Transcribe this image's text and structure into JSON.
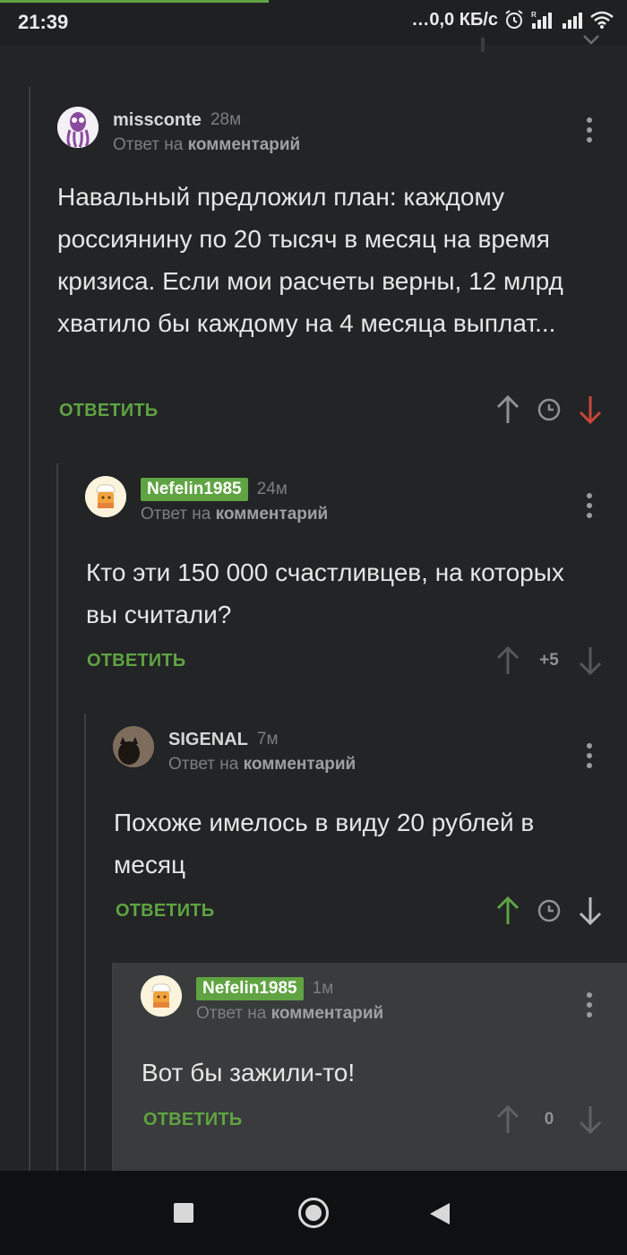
{
  "status_bar": {
    "time": "21:39",
    "network_speed": "…0,0 КБ/с",
    "icons": [
      "alarm-icon",
      "signal-icon",
      "signal-icon",
      "wifi-icon"
    ]
  },
  "comments": [
    {
      "author": "missconte",
      "author_badge": false,
      "ago": "28м",
      "reply_prefix": "Ответ на",
      "reply_target": "комментарий",
      "text": "Навальный предложил план: каждому россиянину по 20 тысяч в месяц на время кризиса. Если мои расчеты верны, 12 млрд хватило бы каждому на 4 месяца выплат...",
      "reply_label": "ОТВЕТИТЬ",
      "score": "",
      "vote": "down"
    },
    {
      "author": "Nefelin1985",
      "author_badge": true,
      "ago": "24м",
      "reply_prefix": "Ответ на",
      "reply_target": "комментарий",
      "text": "Кто эти 150 000 счастливцев, на которых вы считали?",
      "reply_label": "ОТВЕТИТЬ",
      "score": "+5",
      "vote": "none"
    },
    {
      "author": "SIGENAL",
      "author_badge": false,
      "ago": "7м",
      "reply_prefix": "Ответ на",
      "reply_target": "комментарий",
      "text": "Похоже имелось в виду 20 рублей в месяц",
      "reply_label": "ОТВЕТИТЬ",
      "score": "",
      "vote": "up"
    },
    {
      "author": "Nefelin1985",
      "author_badge": true,
      "ago": "1м",
      "reply_prefix": "Ответ на",
      "reply_target": "комментарий",
      "text": "Вот бы зажили-то!",
      "reply_label": "ОТВЕТИТЬ",
      "score": "0",
      "vote": "none"
    }
  ],
  "colors": {
    "accent": "#5fa342",
    "downvote": "#c9453a",
    "background": "#222426",
    "highlight": "#3a3b3c"
  }
}
